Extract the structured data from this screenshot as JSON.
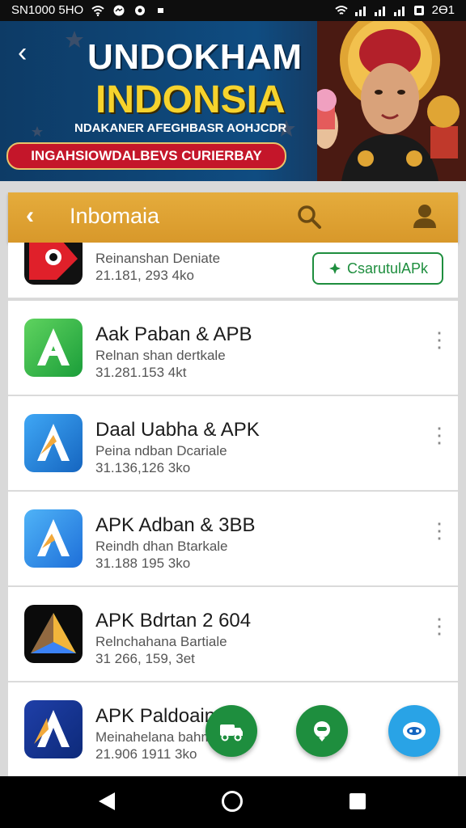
{
  "status_bar": {
    "left_text": "SN1000 5HO",
    "right_text": "2Ɵ1",
    "icons": [
      "wifi-icon",
      "messenger-icon",
      "sync-icon",
      "dot-icon",
      "wifi-icon",
      "signal-icon",
      "signal-icon",
      "signal-icon",
      "battery-icon"
    ]
  },
  "banner": {
    "title": "UNDOKHAM",
    "subtitle": "INDONSIA",
    "tagline": "NDAKANER AFEGHBASR AOHJCDR",
    "ribbon": "INGAHSIOWDALBEVS CURIERBAY",
    "colors": {
      "title": "#ffffff",
      "subtitle": "#f6d32d",
      "ribbon": "#c4162a"
    }
  },
  "appbar": {
    "title": "Inbomaia",
    "icons": [
      "back-chevron-icon",
      "search-icon",
      "user-icon"
    ],
    "color": "#e0a534"
  },
  "list": {
    "first_item": {
      "desc": "Reinanshan Deniate",
      "meta": "21.181, 293 4ko",
      "button_label": "CsarutulAPk",
      "button_color": "#1e8e3e"
    },
    "items": [
      {
        "name": "Aak Paban & APB",
        "desc": "Relnan shan dertkale",
        "meta": "31.281.153 4kt",
        "icon": "green-a-app-icon"
      },
      {
        "name": "Daal Uabha & APK",
        "desc": "Peina ndban Dcariale",
        "meta": "31.136,126 3ko",
        "icon": "blue-a-app-icon"
      },
      {
        "name": "APK Adban & 3BB",
        "desc": "Reindh dhan Btarkale",
        "meta": "31.188 195 3ko",
        "icon": "blue-a-app-icon"
      },
      {
        "name": "APK Bdrtan 2 604",
        "desc": "Relnchahana Bartiale",
        "meta": "31 266, 159, 3et",
        "icon": "triangle-app-icon"
      },
      {
        "name": "APK Paldoain",
        "desc": "Meinahelana bahm",
        "meta": "21.906 1911 3ko",
        "icon": "blue-a-app-icon"
      }
    ]
  },
  "fabs": [
    {
      "icon": "truck-icon",
      "color": "#1e8e3e"
    },
    {
      "icon": "robot-icon",
      "color": "#1e8e3e"
    },
    {
      "icon": "robot-icon",
      "color": "#29a3e6"
    }
  ],
  "navbar": {
    "icons": [
      "back-triangle-icon",
      "home-circle-icon",
      "recents-square-icon"
    ]
  }
}
